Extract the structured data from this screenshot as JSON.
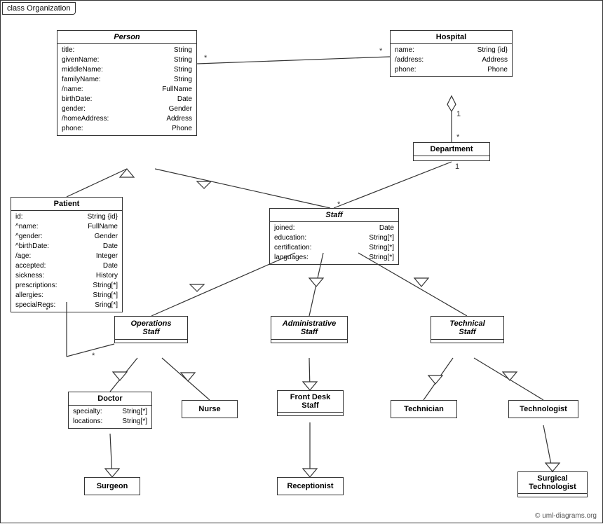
{
  "diagram": {
    "title": "class Organization",
    "copyright": "© uml-diagrams.org",
    "classes": {
      "person": {
        "name": "Person",
        "italic": true,
        "attrs": [
          {
            "name": "title:",
            "type": "String"
          },
          {
            "name": "givenName:",
            "type": "String"
          },
          {
            "name": "middleName:",
            "type": "String"
          },
          {
            "name": "familyName:",
            "type": "String"
          },
          {
            "name": "/name:",
            "type": "FullName"
          },
          {
            "name": "birthDate:",
            "type": "Date"
          },
          {
            "name": "gender:",
            "type": "Gender"
          },
          {
            "name": "/homeAddress:",
            "type": "Address"
          },
          {
            "name": "phone:",
            "type": "Phone"
          }
        ]
      },
      "hospital": {
        "name": "Hospital",
        "attrs": [
          {
            "name": "name:",
            "type": "String {id}"
          },
          {
            "name": "/address:",
            "type": "Address"
          },
          {
            "name": "phone:",
            "type": "Phone"
          }
        ]
      },
      "department": {
        "name": "Department"
      },
      "staff": {
        "name": "Staff",
        "italic": true,
        "attrs": [
          {
            "name": "joined:",
            "type": "Date"
          },
          {
            "name": "education:",
            "type": "String[*]"
          },
          {
            "name": "certification:",
            "type": "String[*]"
          },
          {
            "name": "languages:",
            "type": "String[*]"
          }
        ]
      },
      "patient": {
        "name": "Patient",
        "attrs": [
          {
            "name": "id:",
            "type": "String {id}"
          },
          {
            "name": "^name:",
            "type": "FullName"
          },
          {
            "name": "^gender:",
            "type": "Gender"
          },
          {
            "name": "^birthDate:",
            "type": "Date"
          },
          {
            "name": "/age:",
            "type": "Integer"
          },
          {
            "name": "accepted:",
            "type": "Date"
          },
          {
            "name": "sickness:",
            "type": "History"
          },
          {
            "name": "prescriptions:",
            "type": "String[*]"
          },
          {
            "name": "allergies:",
            "type": "String[*]"
          },
          {
            "name": "specialReqs:",
            "type": "Sring[*]"
          }
        ]
      },
      "operationsStaff": {
        "name": "Operations Staff",
        "italic": true
      },
      "administrativeStaff": {
        "name": "Administrative Staff",
        "italic": true
      },
      "technicalStaff": {
        "name": "Technical Staff",
        "italic": true
      },
      "doctor": {
        "name": "Doctor",
        "attrs": [
          {
            "name": "specialty:",
            "type": "String[*]"
          },
          {
            "name": "locations:",
            "type": "String[*]"
          }
        ]
      },
      "nurse": {
        "name": "Nurse"
      },
      "frontDeskStaff": {
        "name": "Front Desk Staff"
      },
      "technician": {
        "name": "Technician"
      },
      "technologist": {
        "name": "Technologist"
      },
      "surgeon": {
        "name": "Surgeon"
      },
      "receptionist": {
        "name": "Receptionist"
      },
      "surgicalTechnologist": {
        "name": "Surgical Technologist"
      }
    }
  }
}
